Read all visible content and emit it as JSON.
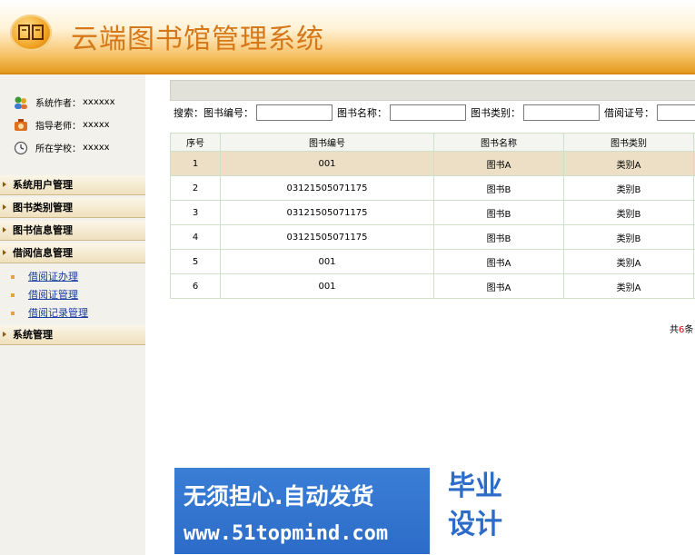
{
  "header": {
    "title": "云端图书馆管理系统"
  },
  "sidebar": {
    "info": [
      {
        "icon": "users-icon",
        "label": "系统作者：",
        "value": "xxxxxx"
      },
      {
        "icon": "teacher-icon",
        "label": "指导老师：",
        "value": "xxxxx"
      },
      {
        "icon": "school-icon",
        "label": "所在学校：",
        "value": "xxxxx"
      }
    ],
    "menu": [
      {
        "label": "系统用户管理"
      },
      {
        "label": "图书类别管理"
      },
      {
        "label": "图书信息管理"
      },
      {
        "label": "借阅信息管理",
        "children": [
          "借阅证办理",
          "借阅证管理",
          "借阅记录管理"
        ]
      },
      {
        "label": "系统管理"
      }
    ]
  },
  "search": {
    "prefix": "搜索：",
    "book_id_label": "图书编号：",
    "book_id_value": "",
    "book_name_label": "图书名称：",
    "book_name_value": "",
    "book_type_label": "图书类别：",
    "book_type_value": "",
    "card_label": "借阅证号：",
    "card_value": ""
  },
  "table": {
    "headers": [
      "序号",
      "图书编号",
      "图书名称",
      "图书类别"
    ],
    "rows": [
      [
        "1",
        "001",
        "图书A",
        "类别A"
      ],
      [
        "2",
        "03121505071175",
        "图书B",
        "类别B"
      ],
      [
        "3",
        "03121505071175",
        "图书B",
        "类别B"
      ],
      [
        "4",
        "03121505071175",
        "图书B",
        "类别B"
      ],
      [
        "5",
        "001",
        "图书A",
        "类别A"
      ],
      [
        "6",
        "001",
        "图书A",
        "类别A"
      ]
    ]
  },
  "pager": {
    "prefix": "共",
    "count": "6",
    "suffix": "条"
  },
  "banner": {
    "line1": "无须担心.自动发货",
    "line2": "www.51topmind.com",
    "box_line1": "毕业",
    "box_line2": "设计"
  },
  "colors": {
    "title": "#d5781a",
    "header_bottom": "#e59a1c",
    "highlight_row": "#ecdfc6",
    "link": "#1a3c9e"
  }
}
